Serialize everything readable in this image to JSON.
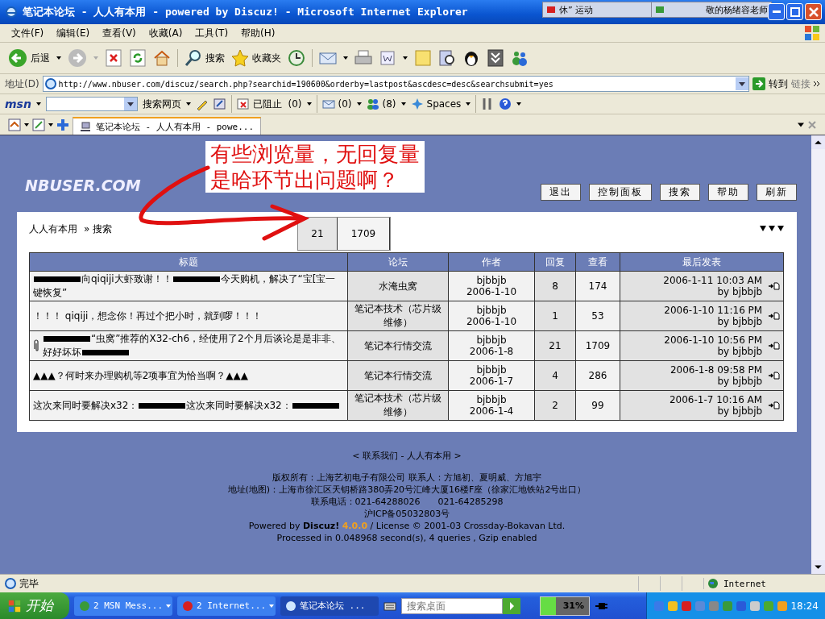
{
  "window": {
    "title": "笔记本论坛 - 人人有本用 - powered by Discuz! - Microsoft Internet Explorer"
  },
  "notifications": [
    {
      "text": "休” 运动"
    },
    {
      "text": "敬的杨绪容老师"
    }
  ],
  "menu": [
    "文件(F)",
    "编辑(E)",
    "查看(V)",
    "收藏(A)",
    "工具(T)",
    "帮助(H)"
  ],
  "toolbar": {
    "back": "后退",
    "search": "搜索",
    "favorites": "收藏夹"
  },
  "address": {
    "label": "地址(D)",
    "url": "http://www.nbuser.com/discuz/search.php?searchid=190600&orderby=lastpost&ascdesc=desc&searchsubmit=yes",
    "go": "转到",
    "links": "链接"
  },
  "msn_toolbar": {
    "logo": "msn",
    "search_web": "搜索网页",
    "blocked": "已阻止",
    "blocked_count": "(0)",
    "mail_count": "(0)",
    "contacts_count": "(8)",
    "spaces": "Spaces"
  },
  "tabs": [
    {
      "label": "笔记本论坛 - 人人有本用 - powe...",
      "selected": true
    }
  ],
  "site": {
    "logo": "NBUSER.COM",
    "nav_buttons": [
      "退出",
      "控制面板",
      "搜索",
      "帮助",
      "刷新"
    ]
  },
  "annotation": {
    "lines": [
      "有些浏览量，无回复量",
      "是哈环节出问题啊？"
    ]
  },
  "overlay_cells": [
    "21",
    "1709"
  ],
  "breadcrumb": {
    "home": "人人有本用",
    "current": "» 搜索"
  },
  "table": {
    "columns": [
      "标题",
      "论坛",
      "作者",
      "回复",
      "查看",
      "最后发表"
    ],
    "rows": [
      {
        "attachment": false,
        "title": [
          {
            "kind": "redaction"
          },
          {
            "kind": "text",
            "text": "向qiqiji大虾致谢！！"
          },
          {
            "kind": "redaction"
          },
          {
            "kind": "text",
            "text": "今天购机，解决了“宝[宝一键恢复”"
          }
        ],
        "forum": "水淹虫窝",
        "author": "bjbbjb",
        "date": "2006-1-10",
        "replies": "8",
        "views": "174",
        "last_post": "2006-1-11 10:03 AM",
        "last_by": "by bjbbjb"
      },
      {
        "attachment": false,
        "title": [
          {
            "kind": "text",
            "text": "！！！ qiqiji，想念你！再过个把小时，就到啰！！！"
          }
        ],
        "forum": "笔记本技术（芯片级维修）",
        "author": "bjbbjb",
        "date": "2006-1-10",
        "replies": "1",
        "views": "53",
        "last_post": "2006-1-10 11:16 PM",
        "last_by": "by bjbbjb"
      },
      {
        "attachment": true,
        "title": [
          {
            "kind": "redaction"
          },
          {
            "kind": "text",
            "text": "“虫窝”推荐的X32-ch6，经使用了2个月后谈论是是非非、好好坏坏"
          },
          {
            "kind": "redaction"
          }
        ],
        "forum": "笔记本行情交流",
        "author": "bjbbjb",
        "date": "2006-1-8",
        "replies": "21",
        "views": "1709",
        "last_post": "2006-1-10 10:56 PM",
        "last_by": "by bjbbjb"
      },
      {
        "attachment": false,
        "title": [
          {
            "kind": "text",
            "text": "▲▲▲？何时来办理购机等2项事宜为恰当啊？▲▲▲"
          }
        ],
        "forum": "笔记本行情交流",
        "author": "bjbbjb",
        "date": "2006-1-7",
        "replies": "4",
        "views": "286",
        "last_post": "2006-1-8 09:58 PM",
        "last_by": "by bjbbjb"
      },
      {
        "attachment": false,
        "title": [
          {
            "kind": "text",
            "text": "这次来同时要解决x32："
          },
          {
            "kind": "redaction"
          },
          {
            "kind": "text",
            "text": "这次来同时要解决x32："
          },
          {
            "kind": "redaction"
          }
        ],
        "forum": "笔记本技术（芯片级维修）",
        "author": "bjbbjb",
        "date": "2006-1-4",
        "replies": "2",
        "views": "99",
        "last_post": "2006-1-7 10:16 AM",
        "last_by": "by bjbbjb"
      }
    ]
  },
  "footer": {
    "contact": "< 联系我们 - 人人有本用 >",
    "lines": [
      "版权所有：上海艺初电子有限公司 联系人：方旭初、夏明威、方旭宇",
      "地址(地图)：上海市徐汇区天钥桥路380弄20号汇峰大厦16楼F座（徐家汇地铁站2号出口）",
      "联系电话：021-64288026　　021-64285298",
      "沪ICP备05032803号"
    ],
    "powered": "Powered by **Discuz!**",
    "version": "4.0.0",
    "license": "/ License © 2001-03 Crossday-Bokavan Ltd.",
    "processed": "Processed in 0.048968 second(s), 4 queries , Gzip enabled"
  },
  "status_bar": {
    "text": "完毕",
    "zone": "Internet"
  },
  "taskbar": {
    "start": "开始",
    "items": [
      {
        "label": "2 MSN Mess...",
        "selected": false
      },
      {
        "label": "2 Internet...",
        "selected": false
      },
      {
        "label": "笔记本论坛 ...",
        "selected": true
      }
    ],
    "search_placeholder": "搜索桌面",
    "battery": {
      "reading": "31%",
      "level": 0.31
    },
    "clock": "18:24"
  }
}
